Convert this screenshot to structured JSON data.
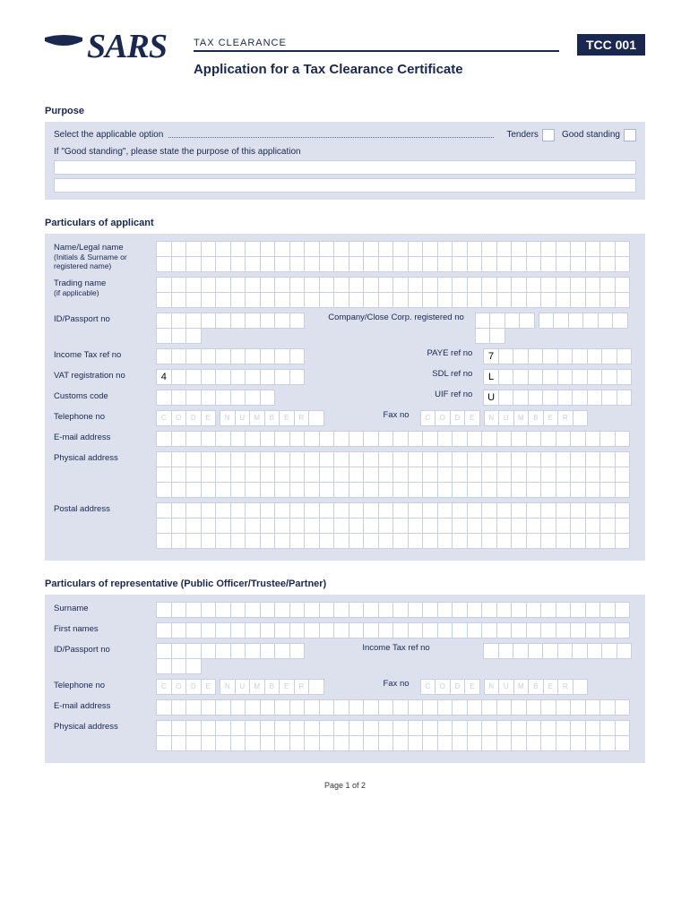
{
  "logo": {
    "text": "SARS"
  },
  "header": {
    "clearance": "TAX CLEARANCE",
    "code": "TCC 001",
    "title": "Application for a Tax Clearance Certificate"
  },
  "purpose": {
    "title": "Purpose",
    "select_label": "Select the applicable option",
    "tenders": "Tenders",
    "good_standing": "Good standing",
    "gs_purpose": "If \"Good standing\", please state the purpose of this application"
  },
  "applicant": {
    "title": "Particulars of applicant",
    "name_label": "Name/Legal name",
    "name_sub": "(Initials & Surname or registered name)",
    "trading_label": "Trading name",
    "trading_sub": "(if applicable)",
    "id_label": "ID/Passport no",
    "company_label": "Company/Close Corp. registered no",
    "income_tax_label": "Income Tax ref no",
    "paye_label": "PAYE ref no",
    "paye_value": "7",
    "vat_label": "VAT registration no",
    "vat_value": "4",
    "sdl_label": "SDL ref no",
    "sdl_value": "L",
    "customs_label": "Customs code",
    "uif_label": "UIF ref no",
    "uif_value": "U",
    "tel_label": "Telephone no",
    "fax_label": "Fax no",
    "email_label": "E-mail address",
    "physical_label": "Physical address",
    "postal_label": "Postal address",
    "code_ghost": "CODE",
    "number_ghost": "NUMBER"
  },
  "representative": {
    "title": "Particulars of representative (Public Officer/Trustee/Partner)",
    "surname_label": "Surname",
    "first_label": "First names",
    "id_label": "ID/Passport no",
    "income_tax_label": "Income Tax ref no",
    "tel_label": "Telephone no",
    "fax_label": "Fax no",
    "email_label": "E-mail address",
    "physical_label": "Physical address"
  },
  "footer": "Page 1 of 2"
}
